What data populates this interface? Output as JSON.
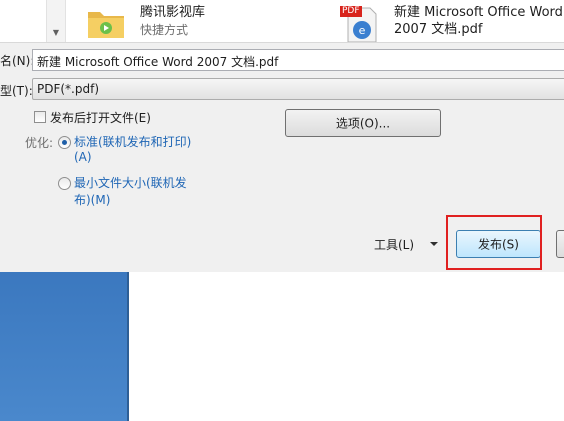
{
  "file_list": {
    "items": [
      {
        "name": "腾讯影视库",
        "subtitle": "快捷方式"
      },
      {
        "name": "新建 Microsoft Office Word",
        "name_line2": "2007 文档.pdf",
        "badge": "PDF"
      }
    ]
  },
  "form": {
    "filename_label": "名(N):",
    "filename_value": "新建 Microsoft Office Word 2007 文档.pdf",
    "type_label": "型(T):",
    "type_value": "PDF(*.pdf)",
    "open_after_publish": "发布后打开文件(E)",
    "open_after_publish_checked": false,
    "optimize_label": "优化:",
    "standard_line1": "标准(联机发布和打印)",
    "standard_line2": "(A)",
    "standard_selected": true,
    "minimum_line1": "最小文件大小(联机发",
    "minimum_line2": "布)(M)",
    "minimum_selected": false,
    "options_button": "选项(O)...",
    "tools_label": "工具(L)",
    "publish_button": "发布(S)"
  },
  "colors": {
    "highlight": "#e02020",
    "link_blue": "#1f66b5",
    "desktop_blue": "#3b78bf"
  },
  "icons": {
    "folder": "folder-icon",
    "pdf": "pdf-file-icon",
    "scroll_down": "scroll-down-icon",
    "dropdown": "dropdown-arrow-icon"
  }
}
